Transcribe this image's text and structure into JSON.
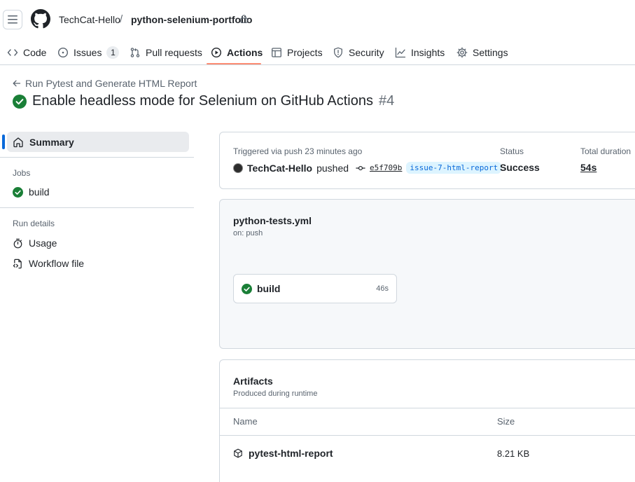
{
  "header": {
    "owner": "TechCat-Hello",
    "separator": "/",
    "repo": "python-selenium-portfolio"
  },
  "nav": {
    "tabs": [
      {
        "label": "Code",
        "icon": "code-icon"
      },
      {
        "label": "Issues",
        "icon": "issue-icon",
        "count": "1"
      },
      {
        "label": "Pull requests",
        "icon": "pull-request-icon"
      },
      {
        "label": "Actions",
        "icon": "play-icon",
        "active": true
      },
      {
        "label": "Projects",
        "icon": "table-icon"
      },
      {
        "label": "Security",
        "icon": "shield-icon"
      },
      {
        "label": "Insights",
        "icon": "graph-icon"
      },
      {
        "label": "Settings",
        "icon": "gear-icon"
      }
    ]
  },
  "run": {
    "workflow_name": "Run Pytest and Generate HTML Report",
    "title": "Enable headless mode for Selenium on GitHub Actions",
    "number": "#4"
  },
  "sidebar": {
    "summary_label": "Summary",
    "jobs_heading": "Jobs",
    "jobs": [
      {
        "label": "build"
      }
    ],
    "run_details_heading": "Run details",
    "details": [
      {
        "label": "Usage",
        "icon": "stopwatch-icon"
      },
      {
        "label": "Workflow file",
        "icon": "file-code-icon"
      }
    ]
  },
  "summary_card": {
    "trigger_text": "Triggered via push 23 minutes ago",
    "actor": "TechCat-Hello",
    "action": "pushed",
    "commit_sha": "e5f709b",
    "branch": "issue-7-html-report",
    "status_label": "Status",
    "status_value": "Success",
    "duration_label": "Total duration",
    "duration_value": "54s"
  },
  "workflow_card": {
    "file": "python-tests.yml",
    "trigger": "on: push",
    "job_name": "build",
    "job_duration": "46s"
  },
  "artifacts": {
    "title": "Artifacts",
    "subtitle": "Produced during runtime",
    "col_name": "Name",
    "col_size": "Size",
    "items": [
      {
        "name": "pytest-html-report",
        "size": "8.21 KB"
      }
    ]
  },
  "colors": {
    "success": "#1a7f37",
    "accent_underline": "#fd8c73",
    "link": "#0969da"
  }
}
